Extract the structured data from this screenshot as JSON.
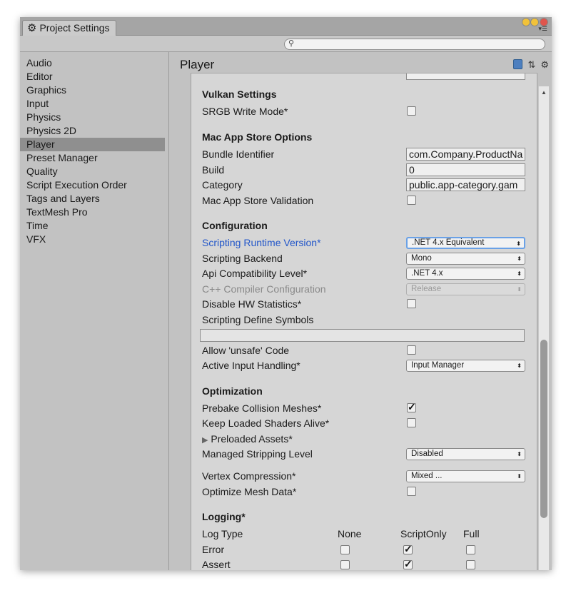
{
  "window": {
    "tab_title": "Project Settings",
    "search_placeholder": ""
  },
  "sidebar": {
    "items": [
      {
        "label": "Audio"
      },
      {
        "label": "Editor"
      },
      {
        "label": "Graphics"
      },
      {
        "label": "Input"
      },
      {
        "label": "Physics"
      },
      {
        "label": "Physics 2D"
      },
      {
        "label": "Player",
        "selected": true
      },
      {
        "label": "Preset Manager"
      },
      {
        "label": "Quality"
      },
      {
        "label": "Script Execution Order"
      },
      {
        "label": "Tags and Layers"
      },
      {
        "label": "TextMesh Pro"
      },
      {
        "label": "Time"
      },
      {
        "label": "VFX"
      }
    ]
  },
  "header": {
    "title": "Player"
  },
  "vulkan": {
    "title": "Vulkan Settings",
    "srgb_label": "SRGB Write Mode*",
    "srgb_checked": false
  },
  "mac": {
    "title": "Mac App Store Options",
    "bundle_label": "Bundle Identifier",
    "bundle_value": "com.Company.ProductNa",
    "build_label": "Build",
    "build_value": "0",
    "category_label": "Category",
    "category_value": "public.app-category.gam",
    "validation_label": "Mac App Store Validation",
    "validation_checked": false
  },
  "config": {
    "title": "Configuration",
    "runtime_label": "Scripting Runtime Version*",
    "runtime_value": ".NET 4.x Equivalent",
    "backend_label": "Scripting Backend",
    "backend_value": "Mono",
    "api_label": "Api Compatibility Level*",
    "api_value": ".NET 4.x",
    "cpp_label": "C++ Compiler Configuration",
    "cpp_value": "Release",
    "hwstats_label": "Disable HW Statistics*",
    "hwstats_checked": false,
    "define_label": "Scripting Define Symbols",
    "define_value": "",
    "unsafe_label": "Allow 'unsafe' Code",
    "unsafe_checked": false,
    "input_label": "Active Input Handling*",
    "input_value": "Input Manager"
  },
  "optimization": {
    "title": "Optimization",
    "prebake_label": "Prebake Collision Meshes*",
    "prebake_checked": true,
    "shaders_label": "Keep Loaded Shaders Alive*",
    "shaders_checked": false,
    "preloaded_label": "Preloaded Assets*",
    "stripping_label": "Managed Stripping Level",
    "stripping_value": "Disabled",
    "vertex_label": "Vertex Compression*",
    "vertex_value": "Mixed ...",
    "optimize_label": "Optimize Mesh Data*",
    "optimize_checked": false
  },
  "logging": {
    "title": "Logging*",
    "log_type_label": "Log Type",
    "columns": [
      "None",
      "ScriptOnly",
      "Full"
    ],
    "rows": [
      {
        "label": "Error",
        "checked": "ScriptOnly"
      },
      {
        "label": "Assert",
        "checked": "ScriptOnly"
      }
    ]
  },
  "colors": {
    "accent_blue": "#2256c9",
    "selected_bg": "#8f8f8f"
  }
}
